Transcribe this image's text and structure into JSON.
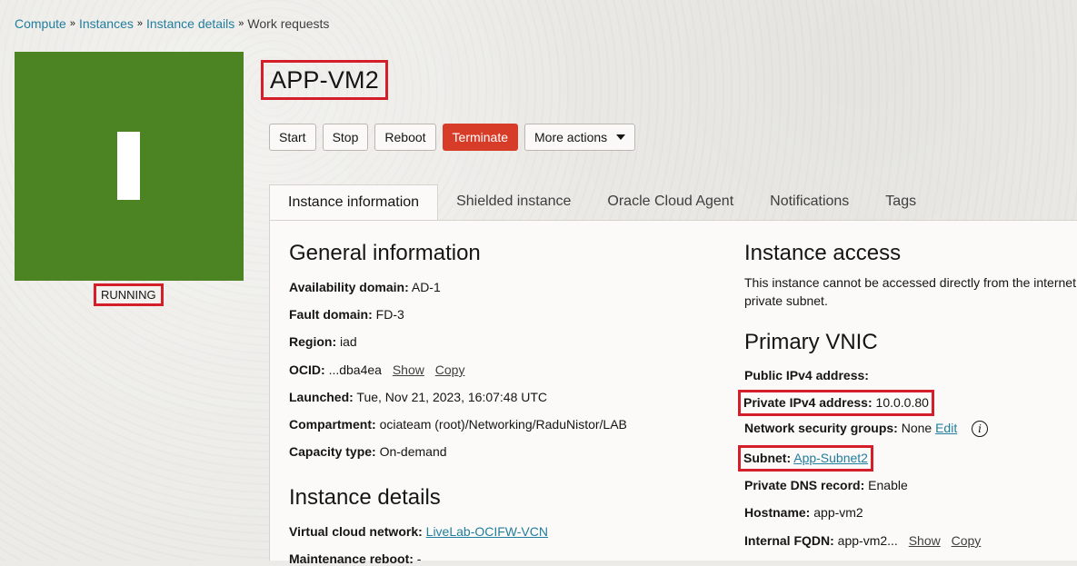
{
  "breadcrumb": {
    "items": [
      "Compute",
      "Instances",
      "Instance details"
    ],
    "current": "Work requests"
  },
  "instance": {
    "tile_letter": "I",
    "state": "RUNNING",
    "name": "APP-VM2",
    "tile_color": "#4d8423"
  },
  "actions": {
    "start": "Start",
    "stop": "Stop",
    "reboot": "Reboot",
    "terminate": "Terminate",
    "more": "More actions"
  },
  "tabs": [
    "Instance information",
    "Shielded instance",
    "Oracle Cloud Agent",
    "Notifications",
    "Tags"
  ],
  "general": {
    "title": "General information",
    "availability_domain": {
      "label": "Availability domain:",
      "value": "AD-1"
    },
    "fault_domain": {
      "label": "Fault domain:",
      "value": "FD-3"
    },
    "region": {
      "label": "Region:",
      "value": "iad"
    },
    "ocid": {
      "label": "OCID:",
      "value": "...dba4ea",
      "show": "Show",
      "copy": "Copy"
    },
    "launched": {
      "label": "Launched:",
      "value": "Tue, Nov 21, 2023, 16:07:48 UTC"
    },
    "compartment": {
      "label": "Compartment:",
      "value": "ociateam (root)/Networking/RaduNistor/LAB"
    },
    "capacity_type": {
      "label": "Capacity type:",
      "value": "On-demand"
    }
  },
  "details": {
    "title": "Instance details",
    "vcn": {
      "label": "Virtual cloud network:",
      "value": "LiveLab-OCIFW-VCN"
    },
    "maintenance": {
      "label": "Maintenance reboot:",
      "value": "-"
    }
  },
  "access": {
    "title": "Instance access",
    "text": "This instance cannot be accessed directly from the internet private subnet."
  },
  "vnic": {
    "title": "Primary VNIC",
    "public_ip": {
      "label": "Public IPv4 address:",
      "value": ""
    },
    "private_ip": {
      "label": "Private IPv4 address:",
      "value": "10.0.0.80"
    },
    "nsg": {
      "label": "Network security groups:",
      "value": "None",
      "edit": "Edit"
    },
    "subnet": {
      "label": "Subnet:",
      "value": "App-Subnet2"
    },
    "dns": {
      "label": "Private DNS record:",
      "value": "Enable"
    },
    "hostname": {
      "label": "Hostname:",
      "value": "app-vm2"
    },
    "fqdn": {
      "label": "Internal FQDN:",
      "value": "app-vm2...",
      "show": "Show",
      "copy": "Copy"
    }
  },
  "colors": {
    "accent_link": "#227e9e",
    "danger": "#d73c28",
    "highlight_box": "#d41f2b"
  }
}
